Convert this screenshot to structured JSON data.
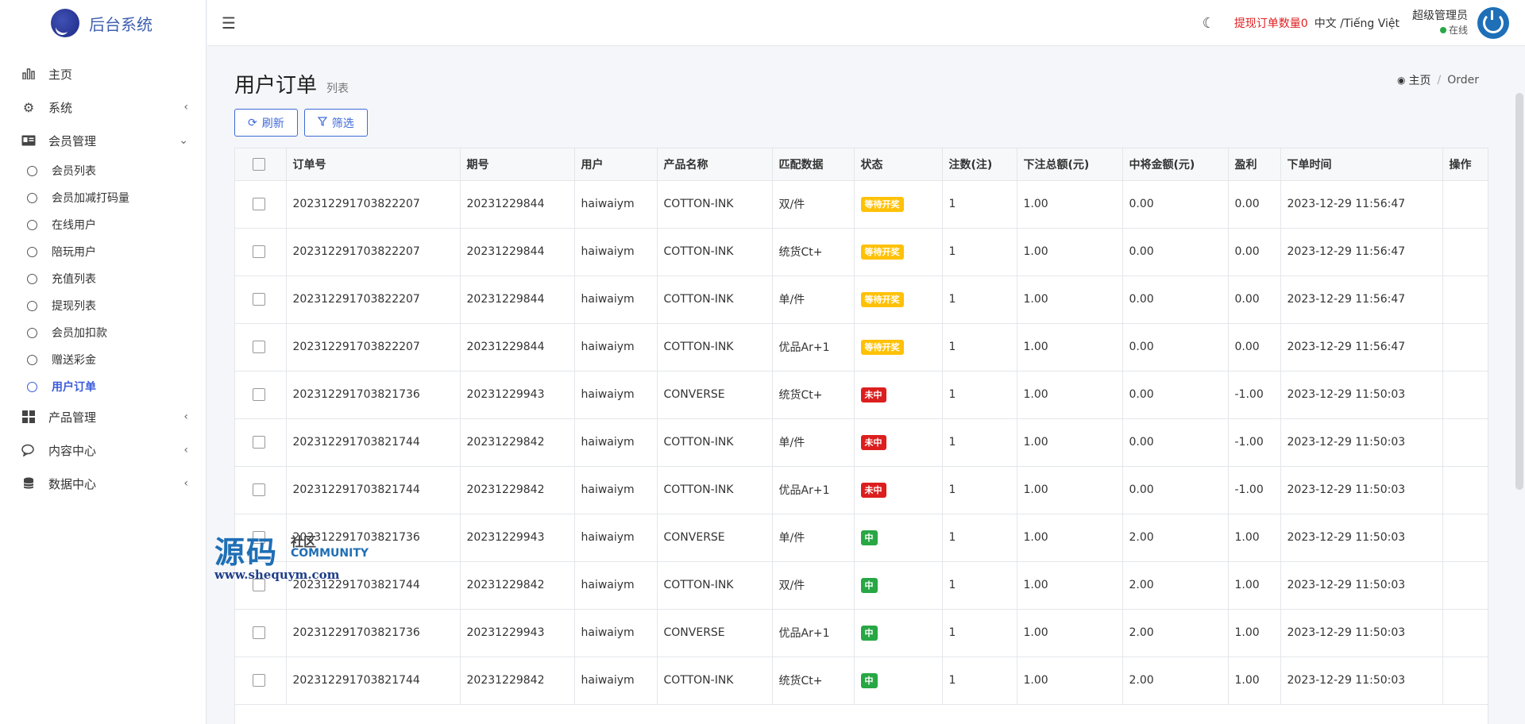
{
  "brand": {
    "title": "后台系统"
  },
  "sidebar": {
    "items": [
      {
        "label": "主页",
        "icon": "bar-chart-icon"
      },
      {
        "label": "系统",
        "icon": "gear-icon",
        "arrow": "‹"
      },
      {
        "label": "会员管理",
        "icon": "id-card-icon",
        "arrow": "⌄"
      }
    ],
    "sub_items": [
      {
        "label": "会员列表"
      },
      {
        "label": "会员加减打码量"
      },
      {
        "label": "在线用户"
      },
      {
        "label": "陪玩用户"
      },
      {
        "label": "充值列表"
      },
      {
        "label": "提现列表"
      },
      {
        "label": "会员加扣款"
      },
      {
        "label": "赠送彩金"
      },
      {
        "label": "用户订单"
      }
    ],
    "bottom_items": [
      {
        "label": "产品管理",
        "icon": "grid-icon",
        "arrow": "‹"
      },
      {
        "label": "内容中心",
        "icon": "chat-icon",
        "arrow": "‹"
      },
      {
        "label": "数据中心",
        "icon": "database-icon",
        "arrow": "‹"
      }
    ]
  },
  "header": {
    "withdraw_label": "提现订单数量0",
    "language": "中文 /Tiếng Việt",
    "user_name": "超级管理员",
    "user_status": "在线"
  },
  "page": {
    "title": "用户订单",
    "subtitle": "列表",
    "breadcrumb_home": "主页",
    "breadcrumb_sep": "/",
    "breadcrumb_current": "Order"
  },
  "toolbar": {
    "refresh_label": "刷新",
    "filter_label": "筛选"
  },
  "table": {
    "headers": [
      "订单号",
      "期号",
      "用户",
      "产品名称",
      "匹配数据",
      "状态",
      "注数(注)",
      "下注总额(元)",
      "中将金额(元)",
      "盈利",
      "下单时间",
      "操作"
    ],
    "rows": [
      [
        "202312291703822207",
        "20231229844",
        "haiwaiym",
        "COTTON-INK",
        "双/件",
        "等待开奖",
        "1",
        "1.00",
        "0.00",
        "0.00",
        "2023-12-29 11:56:47"
      ],
      [
        "202312291703822207",
        "20231229844",
        "haiwaiym",
        "COTTON-INK",
        "统货Ct+",
        "等待开奖",
        "1",
        "1.00",
        "0.00",
        "0.00",
        "2023-12-29 11:56:47"
      ],
      [
        "202312291703822207",
        "20231229844",
        "haiwaiym",
        "COTTON-INK",
        "单/件",
        "等待开奖",
        "1",
        "1.00",
        "0.00",
        "0.00",
        "2023-12-29 11:56:47"
      ],
      [
        "202312291703822207",
        "20231229844",
        "haiwaiym",
        "COTTON-INK",
        "优品Ar+1",
        "等待开奖",
        "1",
        "1.00",
        "0.00",
        "0.00",
        "2023-12-29 11:56:47"
      ],
      [
        "202312291703821736",
        "20231229943",
        "haiwaiym",
        "CONVERSE",
        "统货Ct+",
        "未中",
        "1",
        "1.00",
        "0.00",
        "-1.00",
        "2023-12-29 11:50:03"
      ],
      [
        "202312291703821744",
        "20231229842",
        "haiwaiym",
        "COTTON-INK",
        "单/件",
        "未中",
        "1",
        "1.00",
        "0.00",
        "-1.00",
        "2023-12-29 11:50:03"
      ],
      [
        "202312291703821744",
        "20231229842",
        "haiwaiym",
        "COTTON-INK",
        "优品Ar+1",
        "未中",
        "1",
        "1.00",
        "0.00",
        "-1.00",
        "2023-12-29 11:50:03"
      ],
      [
        "202312291703821736",
        "20231229943",
        "haiwaiym",
        "CONVERSE",
        "单/件",
        "中",
        "1",
        "1.00",
        "2.00",
        "1.00",
        "2023-12-29 11:50:03"
      ],
      [
        "202312291703821744",
        "20231229842",
        "haiwaiym",
        "COTTON-INK",
        "双/件",
        "中",
        "1",
        "1.00",
        "2.00",
        "1.00",
        "2023-12-29 11:50:03"
      ],
      [
        "202312291703821736",
        "20231229943",
        "haiwaiym",
        "CONVERSE",
        "优品Ar+1",
        "中",
        "1",
        "1.00",
        "2.00",
        "1.00",
        "2023-12-29 11:50:03"
      ],
      [
        "202312291703821744",
        "20231229842",
        "haiwaiym",
        "COTTON-INK",
        "统货Ct+",
        "中",
        "1",
        "1.00",
        "2.00",
        "1.00",
        "2023-12-29 11:50:03"
      ]
    ]
  },
  "watermark": {
    "big": "源码",
    "small": "社区",
    "community": "COMMUNITY",
    "url": "www.shequym.com"
  },
  "colors": {
    "accent": "#3f6ad8",
    "wait": "#ffc107",
    "lose": "#dc1e1e",
    "win": "#28a745",
    "alert": "#e02020"
  }
}
